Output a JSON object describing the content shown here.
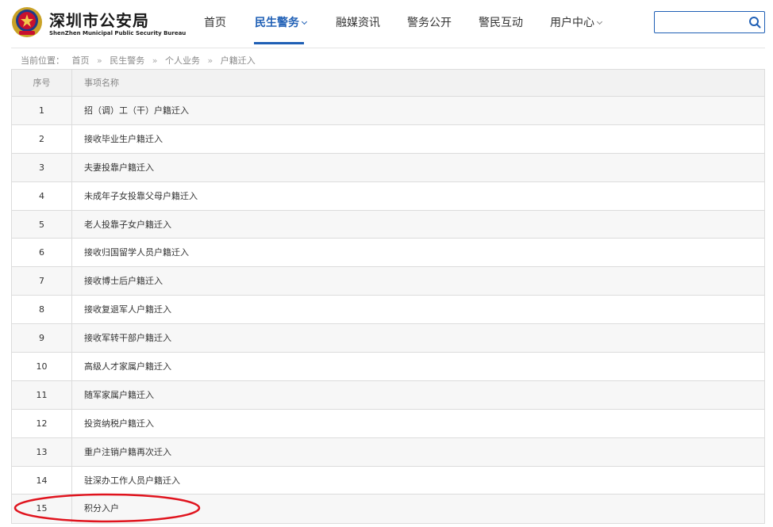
{
  "header": {
    "title": "深圳市公安局",
    "subtitle": "ShenZhen Municipal Public Security Bureau",
    "logo_icon": "police-emblem-icon"
  },
  "nav": {
    "items": [
      {
        "label": "首页",
        "active": false
      },
      {
        "label": "民生警务",
        "active": true,
        "has_dropdown": true
      },
      {
        "label": "融媒资讯",
        "active": false
      },
      {
        "label": "警务公开",
        "active": false
      },
      {
        "label": "警民互动",
        "active": false
      },
      {
        "label": "用户中心",
        "active": false,
        "has_dropdown": true
      }
    ]
  },
  "search": {
    "value": "",
    "placeholder": "",
    "icon": "search-icon"
  },
  "breadcrumb": {
    "prefix": "当前位置：",
    "items": [
      "首页",
      "民生警务",
      "个人业务",
      "户籍迁入"
    ],
    "separator": "»"
  },
  "table": {
    "headers": [
      "序号",
      "事项名称"
    ],
    "rows": [
      {
        "no": "1",
        "name": "招（调）工（干）户籍迁入"
      },
      {
        "no": "2",
        "name": "接收毕业生户籍迁入"
      },
      {
        "no": "3",
        "name": "夫妻投靠户籍迁入"
      },
      {
        "no": "4",
        "name": "未成年子女投靠父母户籍迁入"
      },
      {
        "no": "5",
        "name": "老人投靠子女户籍迁入"
      },
      {
        "no": "6",
        "name": "接收归国留学人员户籍迁入"
      },
      {
        "no": "7",
        "name": "接收博士后户籍迁入"
      },
      {
        "no": "8",
        "name": "接收复退军人户籍迁入"
      },
      {
        "no": "9",
        "name": "接收军转干部户籍迁入"
      },
      {
        "no": "10",
        "name": "高级人才家属户籍迁入"
      },
      {
        "no": "11",
        "name": "随军家属户籍迁入"
      },
      {
        "no": "12",
        "name": "投资纳税户籍迁入"
      },
      {
        "no": "13",
        "name": "重户注销户籍再次迁入"
      },
      {
        "no": "14",
        "name": "驻深办工作人员户籍迁入"
      },
      {
        "no": "15",
        "name": "积分入户"
      }
    ]
  },
  "colors": {
    "accent": "#1f5fb5",
    "highlight": "#e0141e"
  }
}
